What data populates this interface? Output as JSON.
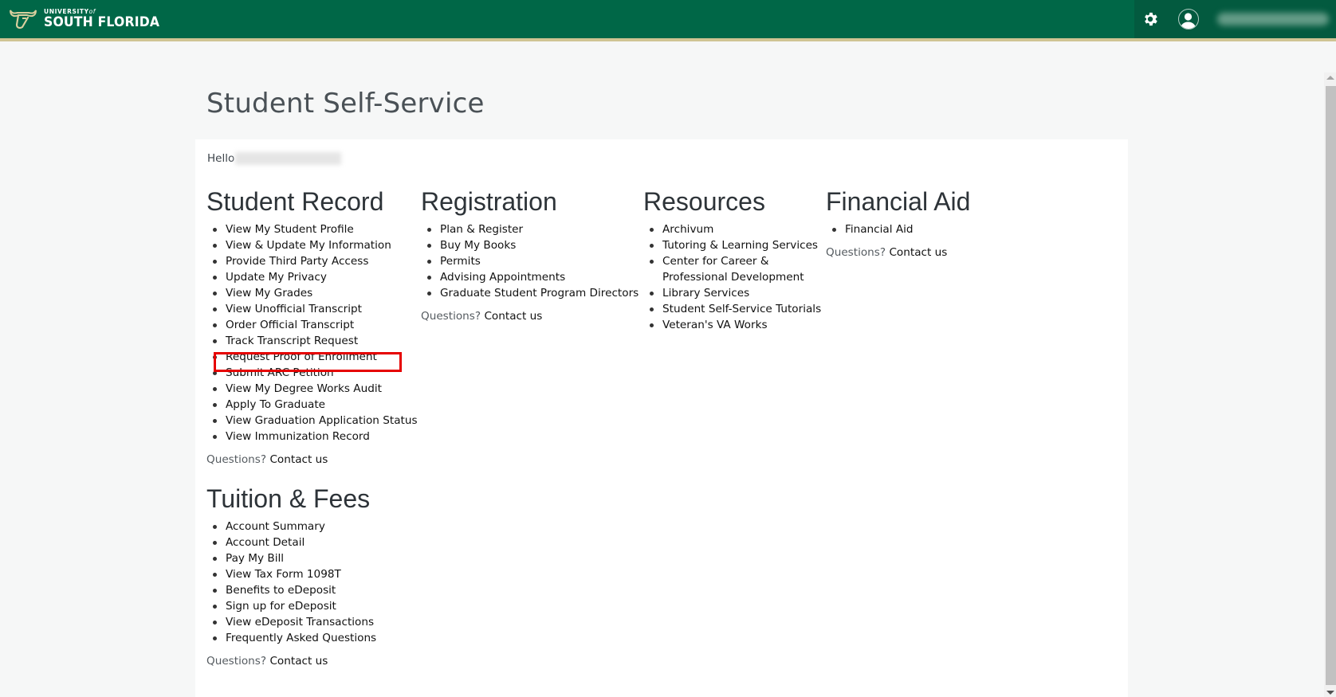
{
  "header": {
    "logo": {
      "line1": "UNIVERSITY",
      "line1_of": "of",
      "line2": "SOUTH FLORIDA",
      "icon": "usf-bull-icon"
    },
    "settings_icon": "gear-icon",
    "user_icon": "user-avatar-icon",
    "colors": {
      "brand_green": "#006747",
      "dark_green": "#035a3f",
      "gold": "#cfc493"
    }
  },
  "page": {
    "title": "Student Self-Service",
    "greeting": "Hello",
    "highlight_color": "#e60000"
  },
  "sections": {
    "student_record": {
      "title": "Student Record",
      "items": [
        "View My Student Profile",
        "View & Update My Information",
        "Provide Third Party Access",
        "Update My Privacy",
        "View My Grades",
        "View Unofficial Transcript",
        "Order Official Transcript",
        "Track Transcript Request",
        "Request Proof of Enrollment",
        "Submit ARC Petition",
        "View My Degree Works Audit",
        "Apply To Graduate",
        "View Graduation Application Status",
        "View Immunization Record"
      ],
      "highlighted_item": "Request Proof of Enrollment",
      "questions": "Questions?",
      "contact": "Contact us"
    },
    "registration": {
      "title": "Registration",
      "items": [
        "Plan & Register",
        "Buy My Books",
        "Permits",
        "Advising Appointments",
        "Graduate Student Program Directors"
      ],
      "questions": "Questions?",
      "contact": "Contact us"
    },
    "resources": {
      "title": "Resources",
      "items": [
        "Archivum",
        "Tutoring & Learning Services",
        "Center for Career & Professional Development",
        "Library Services",
        "Student Self-Service Tutorials",
        "Veteran's VA Works"
      ]
    },
    "financial_aid": {
      "title": "Financial Aid",
      "items": [
        "Financial Aid"
      ],
      "questions": "Questions?",
      "contact": "Contact us"
    },
    "tuition_fees": {
      "title": "Tuition & Fees",
      "items": [
        "Account Summary",
        "Account Detail",
        "Pay My Bill",
        "View Tax Form 1098T",
        "Benefits to eDeposit",
        "Sign up for eDeposit",
        "View eDeposit Transactions",
        "Frequently Asked Questions"
      ],
      "questions": "Questions?",
      "contact": "Contact us"
    }
  }
}
